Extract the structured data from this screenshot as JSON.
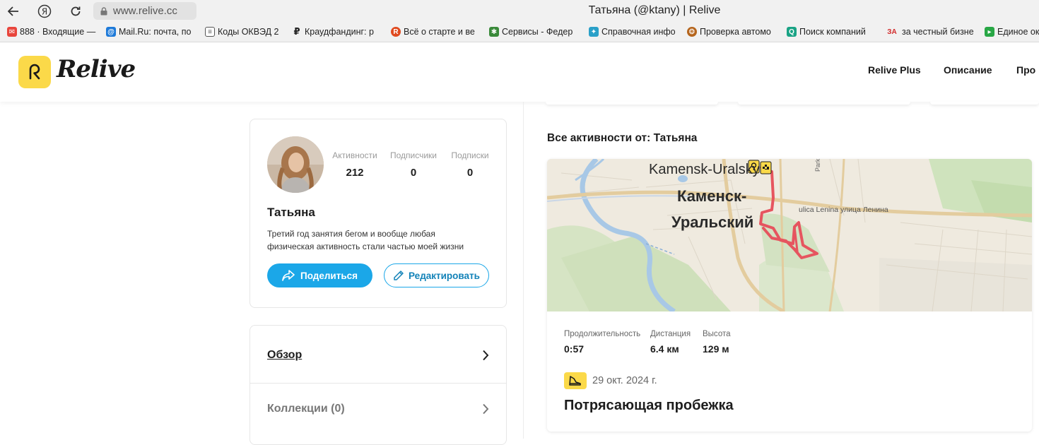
{
  "browser": {
    "url": "www.relive.cc",
    "tab_title": "Татьяна (@ktany) | Relive",
    "bookmarks": [
      {
        "label": "888 · Входящие —",
        "icon": "mail-icon",
        "color": "#e8453c"
      },
      {
        "label": "Mail.Ru: почта, по",
        "icon": "at-icon",
        "color": "#1e7ad9"
      },
      {
        "label": "Коды ОКВЭД 2",
        "icon": "document-icon",
        "color": "#555555"
      },
      {
        "label": "Краудфандинг: р",
        "icon": "ruble-icon",
        "color": "#222222"
      },
      {
        "label": "Всё о старте и ве",
        "icon": "r-badge-icon",
        "color": "#e04a1f"
      },
      {
        "label": "Сервисы - Федер",
        "icon": "emblem-icon",
        "color": "#3a8a3a"
      },
      {
        "label": "Справочная инфо",
        "icon": "pinwheel-icon",
        "color": "#2aa0c8"
      },
      {
        "label": "Проверка автомо",
        "icon": "emblem-icon",
        "color": "#b5651d"
      },
      {
        "label": "Поиск компаний",
        "icon": "search-icon",
        "color": "#1aa385"
      },
      {
        "label": "за честный бизне",
        "icon": "za-icon",
        "color": "#d22a2a"
      },
      {
        "label": "Единое ок",
        "icon": "play-icon",
        "color": "#28a745"
      }
    ]
  },
  "site": {
    "brand": "Relive",
    "menu": [
      "Relive Plus",
      "Описание",
      "Про"
    ]
  },
  "profile": {
    "stats": [
      {
        "label": "Активности",
        "value": "212"
      },
      {
        "label": "Подписчики",
        "value": "0"
      },
      {
        "label": "Подписки",
        "value": "0"
      }
    ],
    "name": "Татьяна",
    "bio": "Третий год занятия бегом и вообще любая физическая активность стали частью моей жизни",
    "share_label": "Поделиться",
    "edit_label": "Редактировать"
  },
  "nav": {
    "overview": "Обзор",
    "collections": "Коллекции (0)"
  },
  "activities": {
    "title": "Все активности от: Татьяна",
    "map_labels": {
      "city_en": "Kamensk-Uralsky",
      "city_ru_1": "Каменск-",
      "city_ru_2": "Уральский",
      "street": "ulica Lenina улица Ленина",
      "side_street": "Parkov"
    },
    "stats": [
      {
        "label": "Продолжительность",
        "value": "0:57"
      },
      {
        "label": "Дистанция",
        "value": "6.4 км"
      },
      {
        "label": "Высота",
        "value": "129 м"
      }
    ],
    "date": "29 окт. 2024 г.",
    "name": "Потрясающая пробежка"
  }
}
